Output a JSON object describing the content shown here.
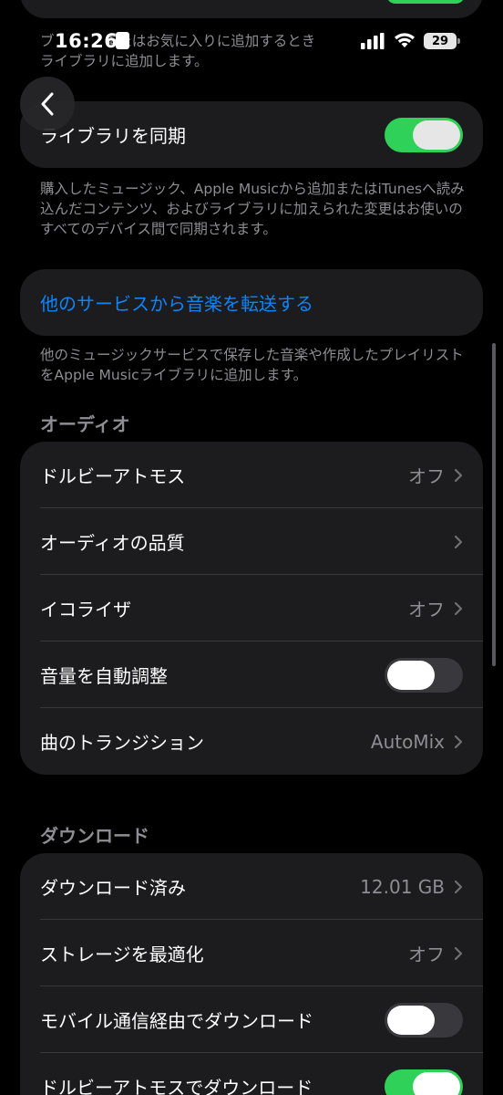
{
  "status_bar": {
    "time": "16:26",
    "battery": "29"
  },
  "top_partial": {
    "note": "ブラ…またはお気に入りに追加するとき…ライブラリに追加します。",
    "note_line1": "ブ           またはお気に入りに追加するとき",
    "note_line2": "ライブラリに追加します。"
  },
  "sync_library": {
    "label": "ライブラリを同期",
    "toggle_on": true,
    "note": "購入したミュージック、Apple Musicから追加またはiTunesへ読み込んだコンテンツ、およびライブラリに加えられた変更はお使いのすべてのデバイス間で同期されます。"
  },
  "transfer": {
    "link": "他のサービスから音楽を転送する",
    "note": "他のミュージックサービスで保存した音楽や作成したプレイリストをApple Musicライブラリに追加します。"
  },
  "audio": {
    "header": "オーディオ",
    "rows": [
      {
        "label": "ドルビーアトモス",
        "value": "オフ"
      },
      {
        "label": "オーディオの品質",
        "value": ""
      },
      {
        "label": "イコライザ",
        "value": "オフ"
      },
      {
        "label": "音量を自動調整",
        "toggle_on": false
      },
      {
        "label": "曲のトランジション",
        "value": "AutoMix"
      }
    ]
  },
  "downloads": {
    "header": "ダウンロード",
    "rows": [
      {
        "label": "ダウンロード済み",
        "value": "12.01 GB"
      },
      {
        "label": "ストレージを最適化",
        "value": "オフ"
      },
      {
        "label": "モバイル通信経由でダウンロード",
        "toggle_on": false
      },
      {
        "label": "ドルビーアトモスでダウンロード",
        "toggle_on": true
      }
    ]
  },
  "colors": {
    "background": "#000000",
    "cell": "#1c1c1e",
    "toggle_on": "#30d158",
    "link": "#0a84ff",
    "secondary_text": "#8d8d93"
  }
}
